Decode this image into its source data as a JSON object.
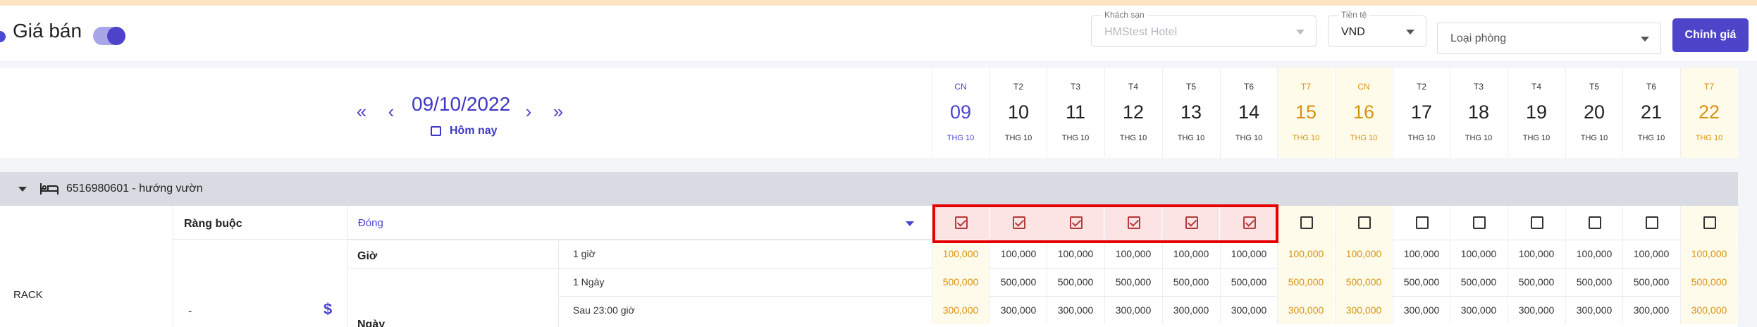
{
  "header": {
    "title": "Giá bán",
    "hotel": {
      "legend": "Khách sạn",
      "value": "HMStest Hotel"
    },
    "currency": {
      "legend": "Tiền tệ",
      "value": "VND"
    },
    "room_type": {
      "placeholder": "Loại phòng"
    },
    "edit_button": "Chỉnh giá"
  },
  "nav": {
    "date": "09/10/2022",
    "today": "Hôm nay",
    "icons": [
      "chevrons-left-icon",
      "chevron-left-icon",
      "chevron-right-icon",
      "chevrons-right-icon",
      "calendar-icon"
    ]
  },
  "days": [
    {
      "dow": "CN",
      "num": "09",
      "mon": "THG 10",
      "kind": "sel"
    },
    {
      "dow": "T2",
      "num": "10",
      "mon": "THG 10",
      "kind": ""
    },
    {
      "dow": "T3",
      "num": "11",
      "mon": "THG 10",
      "kind": ""
    },
    {
      "dow": "T4",
      "num": "12",
      "mon": "THG 10",
      "kind": ""
    },
    {
      "dow": "T5",
      "num": "13",
      "mon": "THG 10",
      "kind": ""
    },
    {
      "dow": "T6",
      "num": "14",
      "mon": "THG 10",
      "kind": ""
    },
    {
      "dow": "T7",
      "num": "15",
      "mon": "THG 10",
      "kind": "wk"
    },
    {
      "dow": "CN",
      "num": "16",
      "mon": "THG 10",
      "kind": "wk"
    },
    {
      "dow": "T2",
      "num": "17",
      "mon": "THG 10",
      "kind": ""
    },
    {
      "dow": "T3",
      "num": "18",
      "mon": "THG 10",
      "kind": ""
    },
    {
      "dow": "T4",
      "num": "19",
      "mon": "THG 10",
      "kind": ""
    },
    {
      "dow": "T5",
      "num": "20",
      "mon": "THG 10",
      "kind": ""
    },
    {
      "dow": "T6",
      "num": "21",
      "mon": "THG 10",
      "kind": ""
    },
    {
      "dow": "T7",
      "num": "22",
      "mon": "THG 10",
      "kind": "wk"
    }
  ],
  "group": {
    "label": "6516980601 - hướng vườn",
    "icon": "bed-icon"
  },
  "grid": {
    "rate_plan": "RACK",
    "constraint_label": "Ràng buộc",
    "constraint_value": "Đóng",
    "dash": "-",
    "dollar": "$",
    "gio_label": "Giờ",
    "ngay_label": "Ngày",
    "closed": [
      true,
      true,
      true,
      true,
      true,
      true,
      false,
      false,
      false,
      false,
      false,
      false,
      false,
      false
    ],
    "rows": [
      {
        "label": "1 giờ",
        "values": [
          "100,000",
          "100,000",
          "100,000",
          "100,000",
          "100,000",
          "100,000",
          "100,000",
          "100,000",
          "100,000",
          "100,000",
          "100,000",
          "100,000",
          "100,000",
          "100,000"
        ]
      },
      {
        "label": "1 Ngày",
        "values": [
          "500,000",
          "500,000",
          "500,000",
          "500,000",
          "500,000",
          "500,000",
          "500,000",
          "500,000",
          "500,000",
          "500,000",
          "500,000",
          "500,000",
          "500,000",
          "500,000"
        ]
      },
      {
        "label": "Sau 23:00 giờ",
        "values": [
          "300,000",
          "300,000",
          "300,000",
          "300,000",
          "300,000",
          "300,000",
          "300,000",
          "300,000",
          "300,000",
          "300,000",
          "300,000",
          "300,000",
          "300,000",
          "300,000"
        ]
      }
    ]
  },
  "colors": {
    "accent": "#4d44c9",
    "weekend": "#d89212",
    "highlight": "#e60000"
  }
}
